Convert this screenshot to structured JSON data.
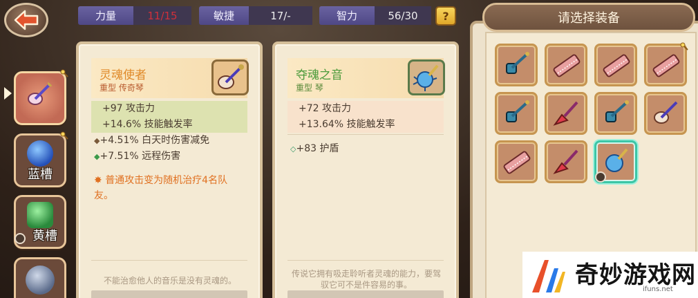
{
  "stats": {
    "strength": {
      "label": "力量",
      "value": "11/15"
    },
    "agility": {
      "label": "敏捷",
      "value": "17/-"
    },
    "intelligence": {
      "label": "智力",
      "value": "56/30"
    },
    "help": "?"
  },
  "slots": [
    {
      "label": "",
      "state": "active"
    },
    {
      "label": "蓝槽",
      "state": "normal"
    },
    {
      "label": "黄槽",
      "state": "locked"
    },
    {
      "label": "",
      "state": "normal"
    }
  ],
  "current_item": {
    "name": "灵魂使者",
    "type": "重型 传奇琴",
    "main_stats": [
      "+97 攻击力",
      "+14.6% 技能触发率"
    ],
    "sub_stats": [
      "+4.51% 白天时伤害减免",
      "+7.51% 远程伤害"
    ],
    "effect": "普通攻击变为随机治疗4名队友。",
    "flavor": "不能治愈他人的音乐是没有灵魂的。"
  },
  "compare_item": {
    "name": "夺魂之音",
    "type": "重型 琴",
    "main_stats": [
      "+72 攻击力",
      "+13.64% 技能触发率"
    ],
    "sub_stats": [
      "+83 护盾"
    ],
    "flavor": "传说它拥有吸走聆听者灵魂的能力，要驾驭它可不是件容易的事。"
  },
  "select_panel": {
    "title": "请选择装备",
    "grid_count": 11
  },
  "watermark": {
    "text": "奇妙游戏网",
    "url": "ifuns.net"
  },
  "colors": {
    "accent_orange": "#e08a2a",
    "stat_red": "#d0303a",
    "selection_teal": "#3cc6a6"
  }
}
